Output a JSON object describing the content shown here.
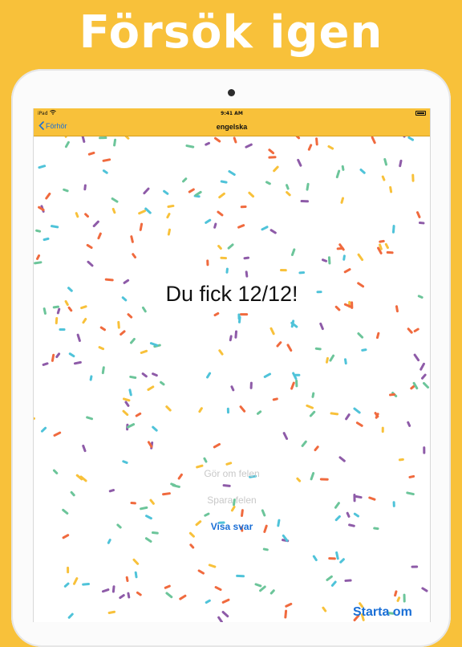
{
  "headline": "Försök igen",
  "status_bar": {
    "device": "iPad",
    "time": "9:41 AM"
  },
  "nav_bar": {
    "back_label": "Förhör",
    "title": "engelska"
  },
  "result": {
    "score_text": "Du fick 12/12!"
  },
  "actions": {
    "redo_wrong": "Gör om felen",
    "save_wrong": "Spara felen",
    "show_answers": "Visa svar",
    "restart": "Starta om"
  },
  "colors": {
    "brand": "#F8C13A",
    "link": "#1a6fd6",
    "confetti": [
      "#F06A3E",
      "#F8C13A",
      "#4FC3D9",
      "#8E5BA8",
      "#6CC59A"
    ]
  }
}
